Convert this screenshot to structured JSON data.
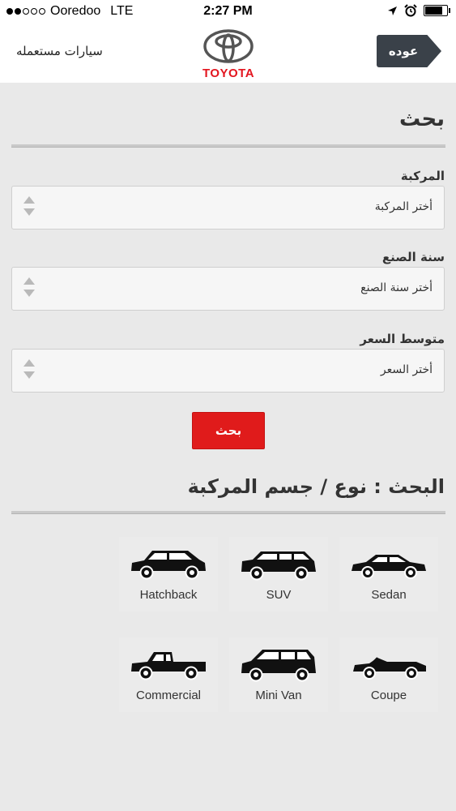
{
  "status_bar": {
    "carrier": "Ooredoo",
    "network": "LTE",
    "time": "2:27 PM",
    "battery_level": 0.8
  },
  "header": {
    "title": "سيارات مستعمله",
    "logo_text": "TOYOTA",
    "back_label": "عوده",
    "brand_color": "#e3151f"
  },
  "search": {
    "title": "بحث",
    "fields": [
      {
        "label": "المركبة",
        "placeholder": "أختر المركبة"
      },
      {
        "label": "سنة الصنع",
        "placeholder": "أختر سنة الصنع"
      },
      {
        "label": "متوسط السعر",
        "placeholder": "أختر السعر"
      }
    ],
    "button_label": "بحث",
    "button_color": "#e01b1b"
  },
  "body_type": {
    "title": "البحث : نوع / جسم المركبة",
    "types": [
      {
        "label": "Sedan",
        "icon": "sedan-icon"
      },
      {
        "label": "SUV",
        "icon": "suv-icon"
      },
      {
        "label": "Hatchback",
        "icon": "hatchback-icon"
      },
      {
        "label": "Coupe",
        "icon": "coupe-icon"
      },
      {
        "label": "Mini Van",
        "icon": "minivan-icon"
      },
      {
        "label": "Commercial",
        "icon": "commercial-icon"
      }
    ]
  }
}
